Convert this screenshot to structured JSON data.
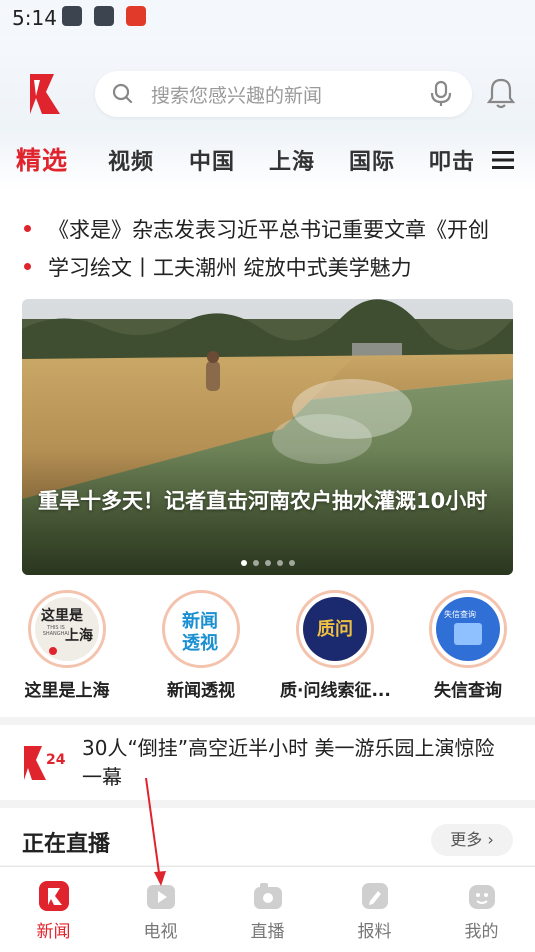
{
  "status_bar": {
    "time": "5:14"
  },
  "search": {
    "placeholder": "搜索您感兴趣的新闻"
  },
  "tabs": [
    {
      "label": "精选",
      "active": true
    },
    {
      "label": "视频"
    },
    {
      "label": "中国"
    },
    {
      "label": "上海"
    },
    {
      "label": "国际"
    },
    {
      "label": "叩击"
    }
  ],
  "headlines": [
    "《求是》杂志发表习近平总书记重要文章《开创",
    "学习绘文丨工夫潮州 绽放中式美学魅力"
  ],
  "banner": {
    "title": "重旱十多天！记者直击河南农户抽水灌溉10小时",
    "slide_count": 5,
    "current_slide": 1
  },
  "shortcuts": [
    {
      "label": "这里是上海",
      "icon_text_1": "这里是",
      "icon_text_2": "上海",
      "icon_small": "THIS IS SHANGHAI"
    },
    {
      "label": "新闻透视",
      "icon_text_1": "新闻",
      "icon_text_2": "透视"
    },
    {
      "label": "质·问线索征...",
      "icon_text_1": "质问"
    },
    {
      "label": "失信查询",
      "icon_text_1": "失信查询"
    }
  ],
  "news_item": {
    "title": "30人“倒挂”高空近半小时 美一游乐园上演惊险一幕"
  },
  "live_section": {
    "title": "正在直播",
    "more_label": "更多 ›"
  },
  "bottom_nav": [
    {
      "label": "新闻",
      "icon": "news-icon",
      "active": true
    },
    {
      "label": "电视",
      "icon": "tv-play-icon"
    },
    {
      "label": "直播",
      "icon": "live-camera-icon"
    },
    {
      "label": "报料",
      "icon": "report-icon"
    },
    {
      "label": "我的",
      "icon": "profile-icon"
    }
  ],
  "colors": {
    "accent": "#e0242e",
    "text": "#222222",
    "muted": "#9a9a9a"
  }
}
